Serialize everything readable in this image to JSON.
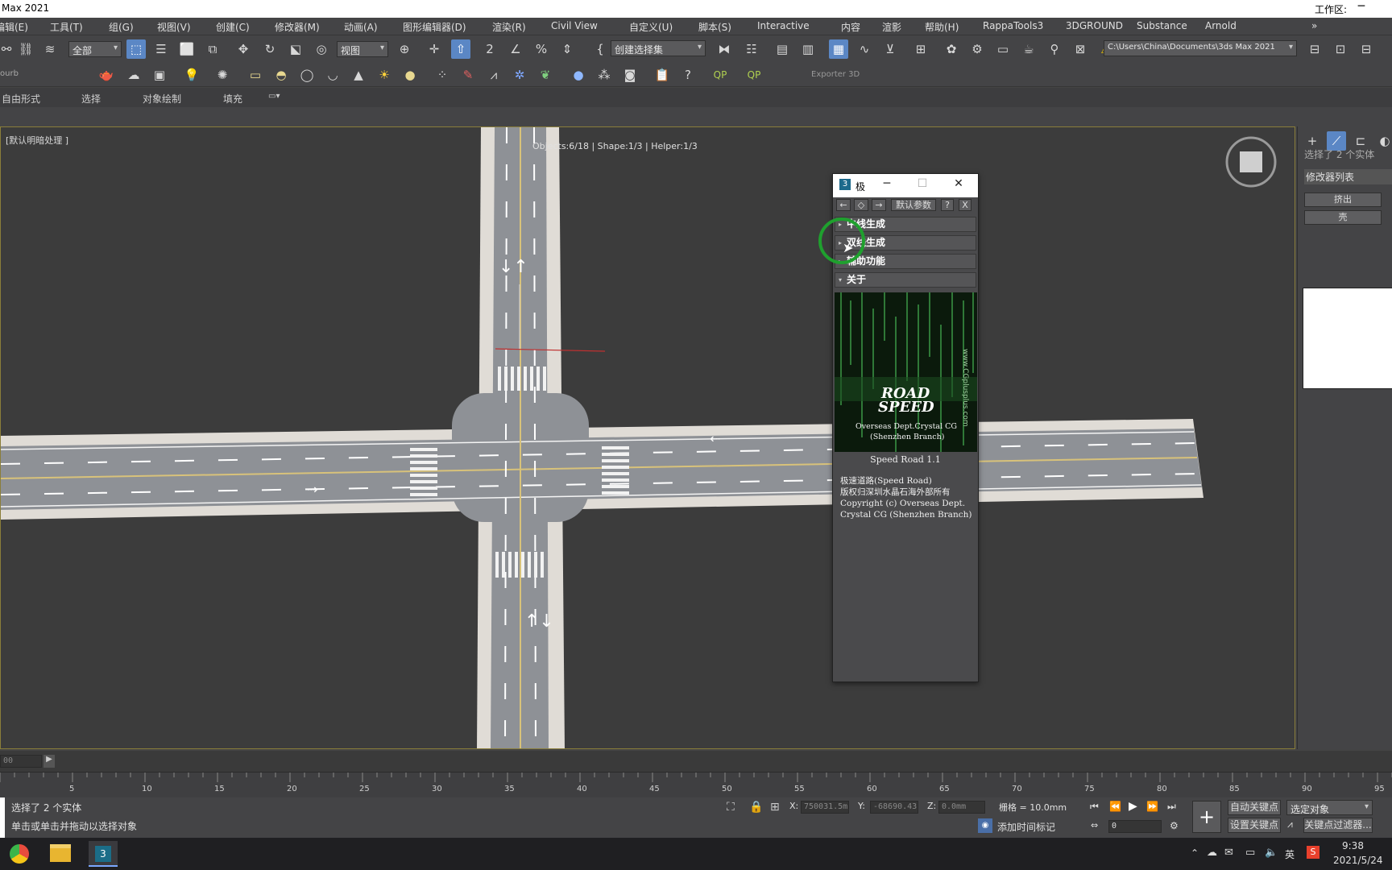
{
  "window": {
    "title": "Max 2021",
    "workspace_label": "工作区:",
    "minimize_glyph": "─"
  },
  "menu": [
    "编辑(E)",
    "工具(T)",
    "组(G)",
    "视图(V)",
    "创建(C)",
    "修改器(M)",
    "动画(A)",
    "图形编辑器(D)",
    "渲染(R)",
    "Civil View",
    "自定义(U)",
    "脚本(S)",
    "Interactive",
    "内容",
    "渲影",
    "帮助(H)",
    "RappaTools3",
    "3DGROUND",
    "Substance",
    "Arnold"
  ],
  "toolbar": {
    "filter_select": "全部",
    "view_select": "视图",
    "selection_set_placeholder": "创建选择集",
    "path_field": "C:\\Users\\China\\Documents\\3ds Max 2021",
    "exporter_label": "Exporter 3D",
    "more_glyph": "»",
    "curb_label": "ourb",
    "qp_label": "QP"
  },
  "ribbon": {
    "tabs": [
      "自由形式",
      "选择",
      "对象绘制",
      "填充"
    ]
  },
  "viewport": {
    "label": "[默认明暗处理 ]",
    "stats": "Objects:6/18 | Shape:1/3 | Helper:1/3"
  },
  "right_panel": {
    "selected": "选择了 2 个实体",
    "modifier_list": "修改器列表",
    "extrude_button": "挤出",
    "shell_button": "壳"
  },
  "dialog": {
    "title": "极",
    "icon_text": "3",
    "title_buttons": {
      "minimize": "─",
      "maximize": "☐",
      "close": "✕"
    },
    "toolbar": {
      "back": "←",
      "diamond": "◇",
      "forward": "→",
      "defaults": "默认参数",
      "help": "?",
      "close": "X"
    },
    "rollouts": [
      {
        "label": "中线生成",
        "state": "collapsed"
      },
      {
        "label": "双线生成",
        "state": "collapsed"
      },
      {
        "label": "辅助功能",
        "state": "collapsed"
      },
      {
        "label": "关于",
        "state": "expanded"
      }
    ],
    "about": {
      "logo_line1": "ROAD",
      "logo_line2": "SPEED",
      "logo_sub1": "Overseas Dept.Crystal CG",
      "logo_sub2": "(Shenzhen Branch)",
      "logo_url": "www.CGplusplus.com",
      "version": "Speed Road 1.1",
      "lines": [
        "极速道路(Speed Road)",
        "版权归深圳水晶石海外部所有",
        "Copyright (c) Overseas Dept.",
        "Crystal CG (Shenzhen Branch)"
      ]
    }
  },
  "timeline": {
    "frame_field": "00",
    "ticks": [
      "5",
      "10",
      "15",
      "20",
      "25",
      "30",
      "35",
      "40",
      "45",
      "50",
      "55",
      "60",
      "65",
      "70",
      "75",
      "80",
      "85",
      "90",
      "95"
    ]
  },
  "status": {
    "selected": "选择了 2 个实体",
    "hint": "单击或单击并拖动以选择对象",
    "x_label": "X:",
    "x_value": "750031.5m",
    "y_label": "Y:",
    "y_value": "-68690.43",
    "z_label": "Z:",
    "z_value": "0.0mm",
    "grid": "栅格 = 10.0mm",
    "add_time_tag": "添加时间标记",
    "auto_key": "自动关键点",
    "set_key": "设置关键点",
    "selected_object": "选定对象",
    "key_filters": "关键点过滤器...",
    "frame_value": "0"
  },
  "taskbar": {
    "app_icon_label": "3",
    "tray": {
      "ime": "英",
      "time": "9:38",
      "date": "2021/5/24"
    }
  },
  "colors": {
    "accent": "#5b87c5",
    "viewport_bg": "#3c3c3c",
    "road": "#8e9196",
    "sidewalk": "#e0dcd6",
    "cursor_ring": "#1fa02e"
  }
}
